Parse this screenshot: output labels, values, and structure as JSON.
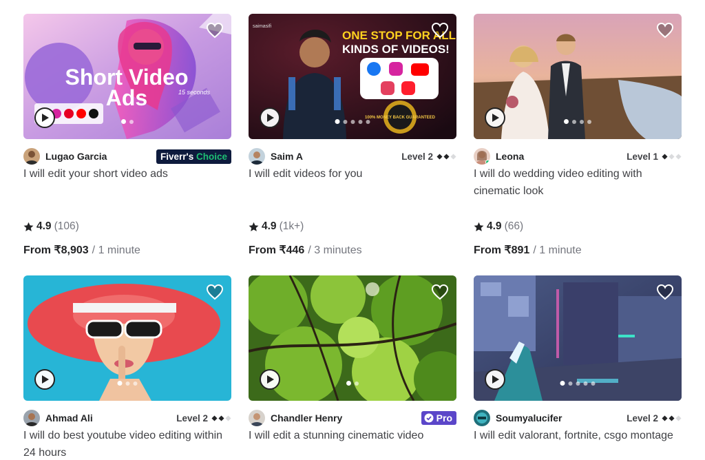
{
  "colors": {
    "fiverr_green": "#1dbf73",
    "choice_badge_bg": "#0e1b3d",
    "pro_badge_bg": "#5b46c9",
    "text_primary": "#222325",
    "text_secondary": "#74767e"
  },
  "gigs": [
    {
      "seller": "Lugao Garcia",
      "badge_type": "fiverrs-choice",
      "badge_prefix": "Fiverr's",
      "badge_accent": "Choice",
      "title": "I will edit your short video ads",
      "rating": "4.9",
      "reviews": "(106)",
      "price": "From ₹8,903",
      "delivery": "/ 1 minute",
      "thumb_text_1": "Short Video",
      "thumb_text_2": "Ads",
      "thumb_text_3": "15 seconds",
      "slides": 2,
      "active_slide": 0,
      "liked": false
    },
    {
      "seller": "Saim A",
      "badge_type": "level",
      "level": "Level 2",
      "level_filled": 2,
      "title": "I will edit videos for you",
      "rating": "4.9",
      "reviews": "(1k+)",
      "price": "From ₹446",
      "delivery": "/ 3 minutes",
      "thumb_text_1": "ONE STOP FOR ALL",
      "thumb_text_2": "KINDS OF VIDEOS!",
      "thumb_text_3": "saimasifi",
      "thumb_text_4": "100% MONEY BACK GUARANTEED",
      "slides": 5,
      "active_slide": 0,
      "liked": false
    },
    {
      "seller": "Leona",
      "badge_type": "level",
      "level": "Level 1",
      "level_filled": 1,
      "online": true,
      "title": "I will do wedding video editing with cinematic look",
      "rating": "4.9",
      "reviews": "(66)",
      "price": "From ₹891",
      "delivery": "/ 1 minute",
      "slides": 4,
      "active_slide": 0,
      "liked": false
    },
    {
      "seller": "Ahmad Ali",
      "badge_type": "level",
      "level": "Level 2",
      "level_filled": 2,
      "title": "I will do best youtube video editing within 24 hours",
      "slides": 3,
      "active_slide": 0,
      "liked": false
    },
    {
      "seller": "Chandler Henry",
      "badge_type": "pro",
      "badge_label": "Pro",
      "title": "I will edit a stunning cinematic video",
      "slides": 2,
      "active_slide": 0,
      "liked": false
    },
    {
      "seller": "Soumyalucifer",
      "badge_type": "level",
      "level": "Level 2",
      "level_filled": 2,
      "title": "I will edit valorant, fortnite, csgo montage",
      "slides": 5,
      "active_slide": 0,
      "liked": false
    }
  ]
}
